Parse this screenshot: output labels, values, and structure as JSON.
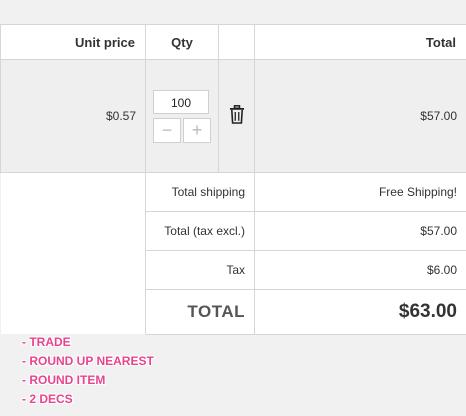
{
  "table": {
    "headers": {
      "unit_price": "Unit price",
      "qty": "Qty",
      "trash": "",
      "total": "Total"
    },
    "item": {
      "unit_price": "$0.57",
      "qty": "100",
      "total": "$57.00",
      "decrement_icon": "minus-icon",
      "increment_icon": "plus-icon",
      "delete_icon": "trash-icon"
    },
    "summary": {
      "shipping_label": "Total shipping",
      "shipping_value": "Free Shipping!",
      "tax_excl_label": "Total (tax excl.)",
      "tax_excl_value": "$57.00",
      "tax_label": "Tax",
      "tax_value": "$6.00",
      "total_label": "TOTAL",
      "total_value": "$63.00"
    }
  },
  "notes": [
    "- TRADE",
    "- ROUND UP NEAREST",
    "- ROUND ITEM",
    "- 2 DECS"
  ],
  "colors": {
    "note_text": "#e8438f",
    "item_row_bg": "#efefef",
    "border": "#d6d6d6"
  }
}
